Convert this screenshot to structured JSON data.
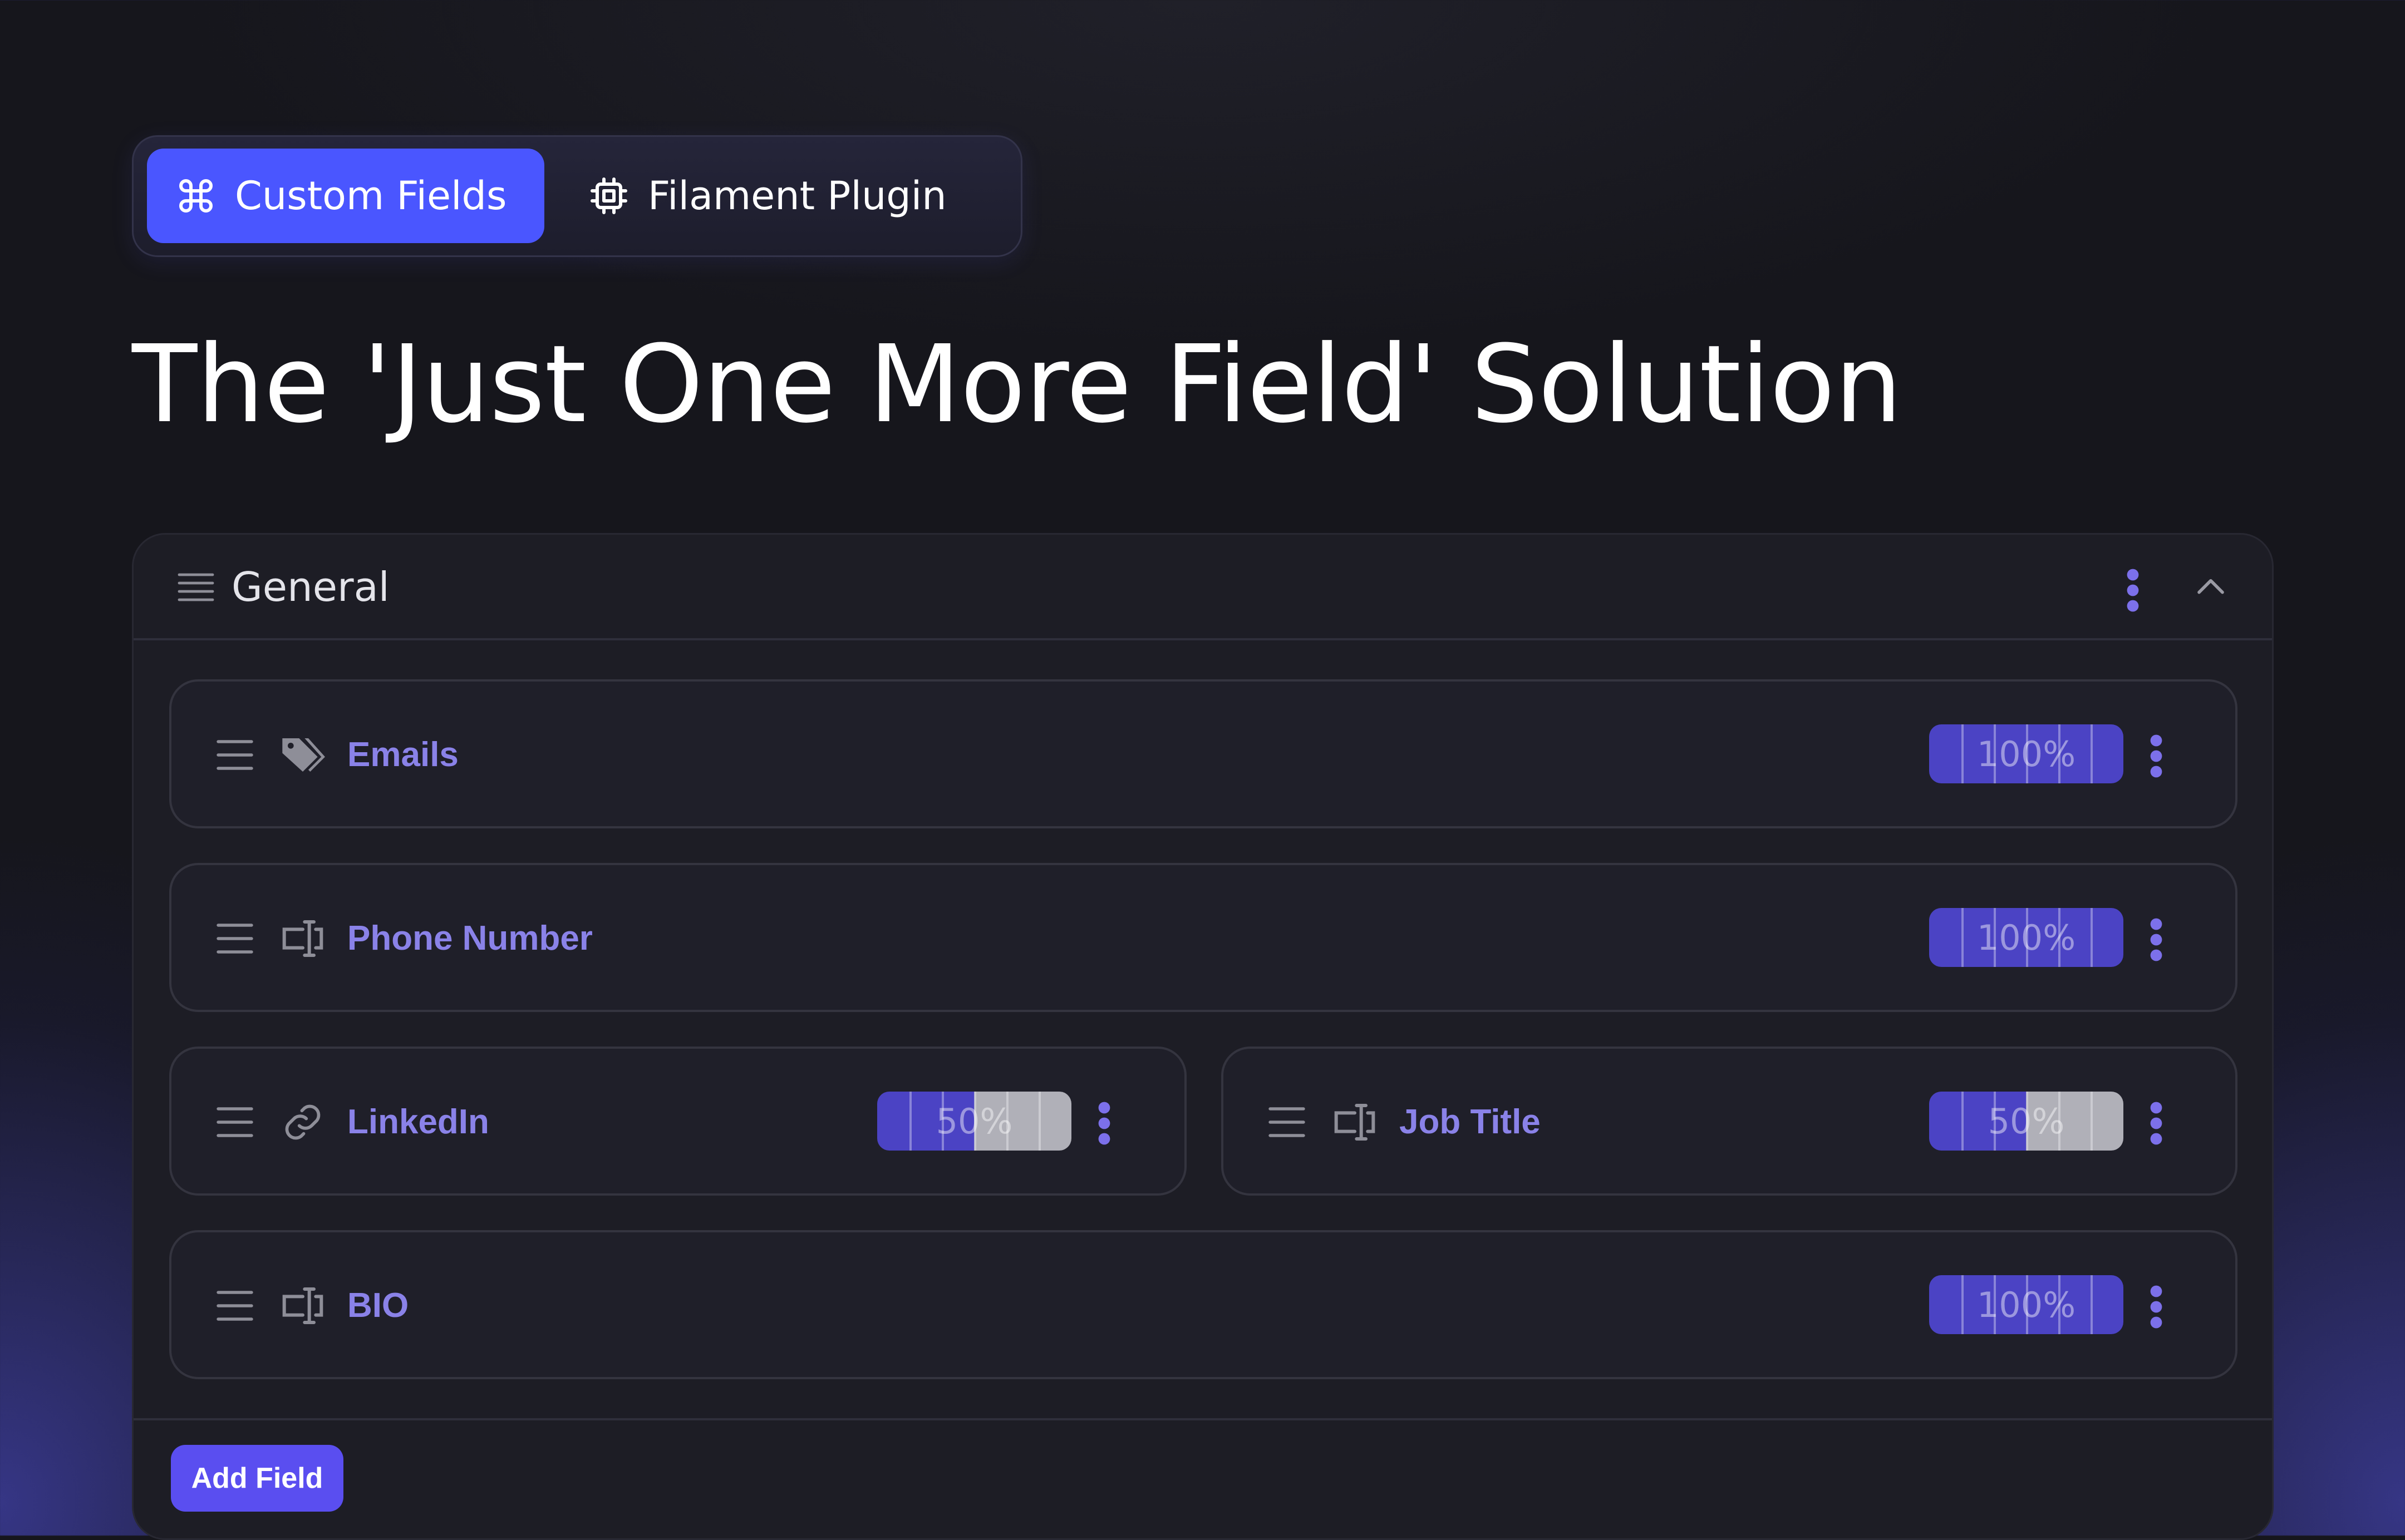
{
  "tabs": [
    {
      "label": "Custom Fields",
      "icon": "command-icon",
      "active": true
    },
    {
      "label": "Filament Plugin",
      "icon": "chip-icon",
      "active": false
    }
  ],
  "headline": "The 'Just One More Field' Solution",
  "section": {
    "title": "General",
    "fields": [
      {
        "label": "Emails",
        "icon": "tag-icon",
        "width": "100%"
      },
      {
        "label": "Phone Number",
        "icon": "text-input-icon",
        "width": "100%"
      },
      {
        "label": "LinkedIn",
        "icon": "link-icon",
        "width": "50%"
      },
      {
        "label": "Job Title",
        "icon": "text-input-icon",
        "width": "50%"
      },
      {
        "label": "BIO",
        "icon": "text-input-icon",
        "width": "100%"
      }
    ],
    "add_button_label": "Add Field"
  },
  "colors": {
    "accent": "#4a56ff",
    "field_label": "#8a82e8",
    "width_bar": "#4b43c4",
    "background": "#16161c",
    "panel": "#1d1d25"
  }
}
